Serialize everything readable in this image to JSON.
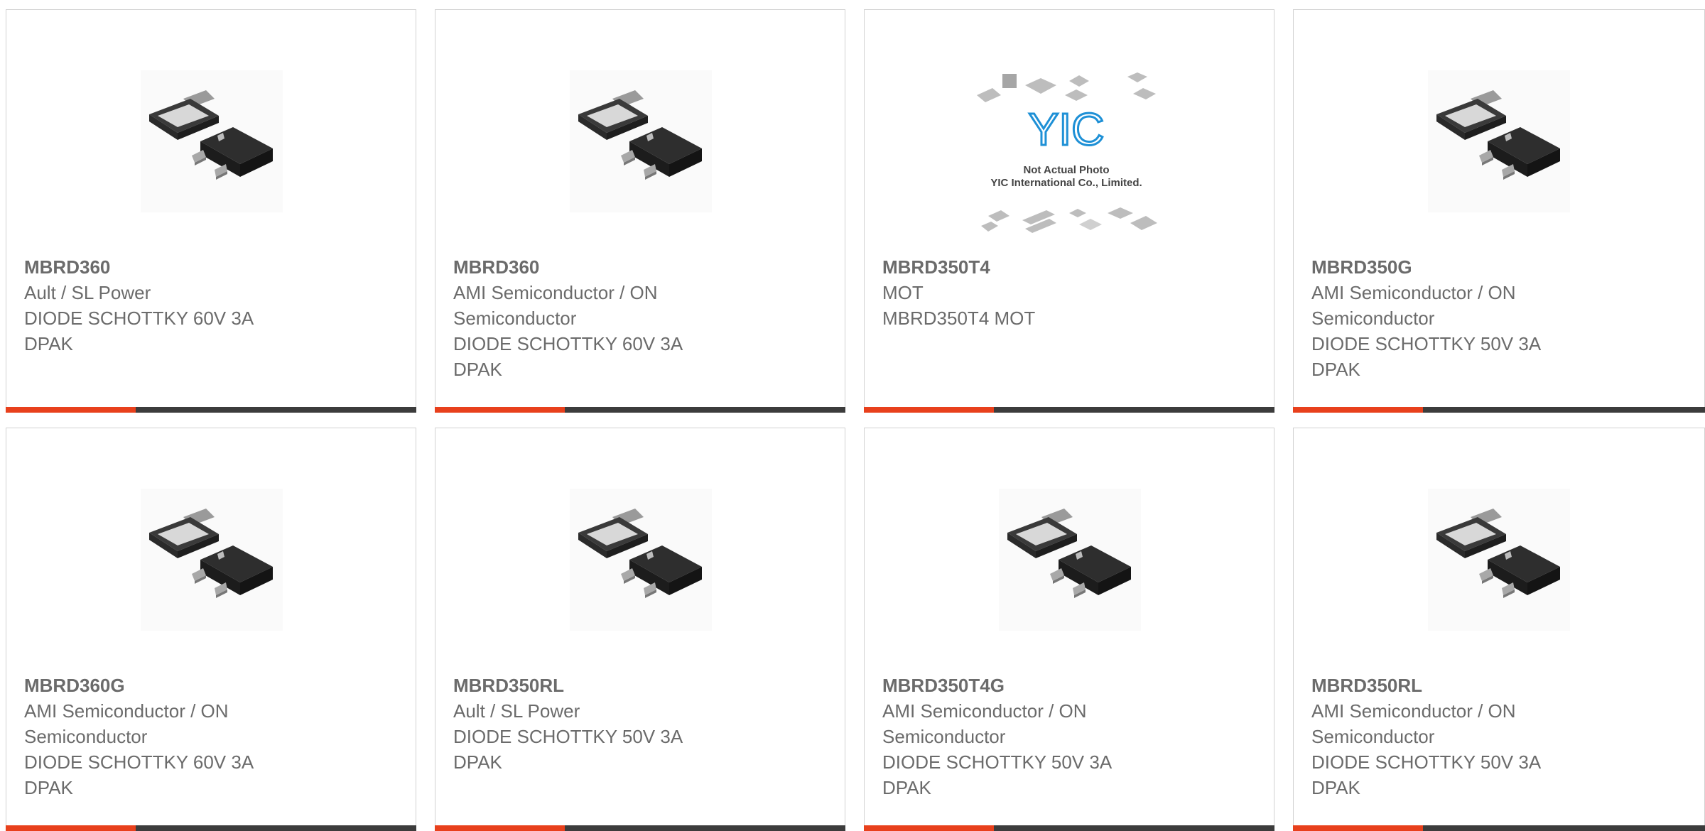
{
  "accent_color": "#e8401c",
  "bar_color": "#3c3c3c",
  "products": [
    {
      "part": "MBRD360",
      "manufacturer": "Ault / SL Power",
      "desc1": "DIODE SCHOTTKY 60V 3A",
      "desc2": "DPAK",
      "image": "dpak-package"
    },
    {
      "part": "MBRD360",
      "manufacturer": "AMI Semiconductor / ON Semiconductor",
      "desc1": "DIODE SCHOTTKY 60V 3A",
      "desc2": "DPAK",
      "image": "dpak-package"
    },
    {
      "part": "MBRD350T4",
      "manufacturer": "MOT",
      "desc1": "MBRD350T4 MOT",
      "desc2": "",
      "image": "placeholder-logo",
      "placeholder_brand": "YIC",
      "placeholder_line1": "Not Actual Photo",
      "placeholder_line2": "YIC International Co., Limited."
    },
    {
      "part": "MBRD350G",
      "manufacturer": "AMI Semiconductor / ON Semiconductor",
      "desc1": "DIODE SCHOTTKY 50V 3A",
      "desc2": "DPAK",
      "image": "dpak-package"
    },
    {
      "part": "MBRD360G",
      "manufacturer": "AMI Semiconductor / ON Semiconductor",
      "desc1": "DIODE SCHOTTKY 60V 3A",
      "desc2": "DPAK",
      "image": "dpak-package"
    },
    {
      "part": "MBRD350RL",
      "manufacturer": "Ault / SL Power",
      "desc1": "DIODE SCHOTTKY 50V 3A",
      "desc2": "DPAK",
      "image": "dpak-package"
    },
    {
      "part": "MBRD350T4G",
      "manufacturer": "AMI Semiconductor / ON Semiconductor",
      "desc1": "DIODE SCHOTTKY 50V 3A",
      "desc2": "DPAK",
      "image": "dpak-package"
    },
    {
      "part": "MBRD350RL",
      "manufacturer": "AMI Semiconductor / ON Semiconductor",
      "desc1": "DIODE SCHOTTKY 50V 3A",
      "desc2": "DPAK",
      "image": "dpak-package"
    }
  ]
}
